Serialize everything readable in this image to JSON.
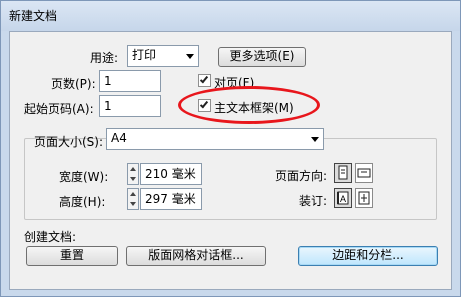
{
  "window": {
    "title": "新建文档"
  },
  "purpose": {
    "label": "用途",
    "hotkey": "",
    "value": "打印"
  },
  "more_options_button": "更多选项(E)",
  "pages": {
    "label": "页数(P):",
    "value": "1"
  },
  "facing_pages": {
    "label": "对页(F)",
    "checked": true
  },
  "start_page": {
    "label": "起始页码(A):",
    "value": "1"
  },
  "master_text_frame": {
    "label": "主文本框架(M)",
    "checked": true
  },
  "page_size_group": {
    "label": "页面大小(S):",
    "value": "A4",
    "width": {
      "label": "宽度(W):",
      "value": "210 毫米"
    },
    "height": {
      "label": "高度(H):",
      "value": "297 毫米"
    },
    "orientation_label": "页面方向:",
    "binding_label": "装订:"
  },
  "create_document": {
    "label": "创建文档:"
  },
  "buttons": {
    "reset": "重置",
    "layout_grid": "版面网格对话框...",
    "margins_columns": "边距和分栏..."
  },
  "colors": {
    "annotation_red": "#e8161c",
    "accent": "#3c7fb1"
  },
  "icons": [
    "portrait-orientation-icon",
    "landscape-orientation-icon",
    "left-binding-icon",
    "right-binding-icon",
    "spin-up-icon",
    "spin-down-icon"
  ]
}
